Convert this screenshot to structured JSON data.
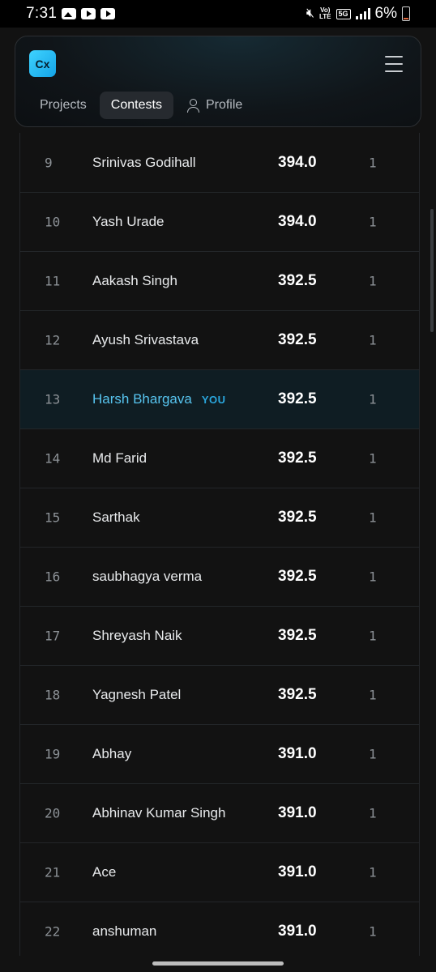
{
  "status": {
    "time": "7:31",
    "volte_top": "Vo)",
    "volte_bottom": "LTE",
    "network": "5G",
    "battery": "6%"
  },
  "nav": {
    "logo": "Cx",
    "tabs": [
      {
        "label": "Projects"
      },
      {
        "label": "Contests"
      },
      {
        "label": "Profile"
      }
    ],
    "active_tab": "Contests"
  },
  "leaderboard": {
    "you_label": "YOU",
    "rows": [
      {
        "rank": "9",
        "name": "Srinivas Godihall",
        "score": "394.0",
        "solved": "1"
      },
      {
        "rank": "10",
        "name": "Yash Urade",
        "score": "394.0",
        "solved": "1"
      },
      {
        "rank": "11",
        "name": "Aakash Singh",
        "score": "392.5",
        "solved": "1"
      },
      {
        "rank": "12",
        "name": "Ayush Srivastava",
        "score": "392.5",
        "solved": "1"
      },
      {
        "rank": "13",
        "name": "Harsh Bhargava",
        "score": "392.5",
        "solved": "1"
      },
      {
        "rank": "14",
        "name": "Md Farid",
        "score": "392.5",
        "solved": "1"
      },
      {
        "rank": "15",
        "name": "Sarthak",
        "score": "392.5",
        "solved": "1"
      },
      {
        "rank": "16",
        "name": "saubhagya verma",
        "score": "392.5",
        "solved": "1"
      },
      {
        "rank": "17",
        "name": "Shreyash Naik",
        "score": "392.5",
        "solved": "1"
      },
      {
        "rank": "18",
        "name": "Yagnesh Patel",
        "score": "392.5",
        "solved": "1"
      },
      {
        "rank": "19",
        "name": "Abhay",
        "score": "391.0",
        "solved": "1"
      },
      {
        "rank": "20",
        "name": "Abhinav Kumar Singh",
        "score": "391.0",
        "solved": "1"
      },
      {
        "rank": "21",
        "name": "Ace",
        "score": "391.0",
        "solved": "1"
      },
      {
        "rank": "22",
        "name": "anshuman",
        "score": "391.0",
        "solved": "1"
      }
    ]
  }
}
